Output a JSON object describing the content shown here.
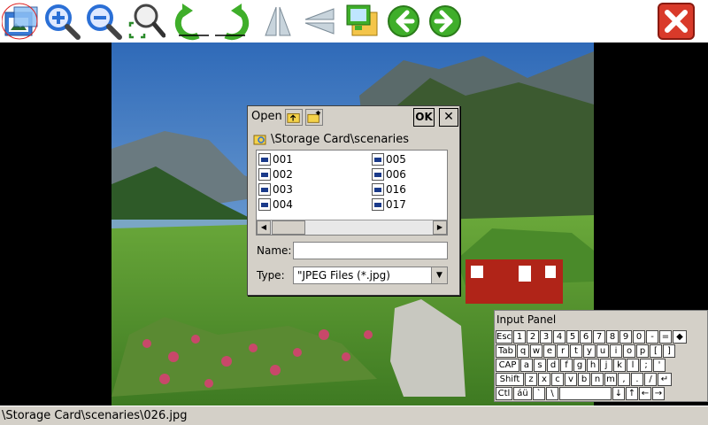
{
  "toolbar": {
    "buttons": [
      {
        "name": "open-image-icon"
      },
      {
        "name": "zoom-in-icon"
      },
      {
        "name": "zoom-out-icon"
      },
      {
        "name": "zoom-fit-icon"
      },
      {
        "name": "rotate-left-icon"
      },
      {
        "name": "rotate-right-icon"
      },
      {
        "name": "flip-horizontal-icon"
      },
      {
        "name": "flip-vertical-icon"
      },
      {
        "name": "slideshow-icon"
      },
      {
        "name": "previous-arrow-icon"
      },
      {
        "name": "next-arrow-icon"
      },
      {
        "name": "close-app-icon"
      }
    ],
    "colors": {
      "accent_green": "#3fae2a",
      "accent_blue": "#2a6fd6",
      "close_red": "#d93a2a"
    }
  },
  "dialog": {
    "title": "Open",
    "ok_label": "OK",
    "close_label": "✕",
    "path": "\\Storage Card\\scenaries",
    "files_col1": [
      "001",
      "002",
      "003",
      "004"
    ],
    "files_col2": [
      "005",
      "006",
      "016",
      "017"
    ],
    "name_label": "Name:",
    "name_value": "",
    "type_label": "Type:",
    "type_value": "\"JPEG Files (*.jpg)"
  },
  "input_panel": {
    "title": "Input Panel",
    "rows": [
      [
        "Esc",
        "1",
        "2",
        "3",
        "4",
        "5",
        "6",
        "7",
        "8",
        "9",
        "0",
        "-",
        "=",
        "◆"
      ],
      [
        "Tab",
        "q",
        "w",
        "e",
        "r",
        "t",
        "y",
        "u",
        "i",
        "o",
        "p",
        "[",
        "]"
      ],
      [
        "CAP",
        "a",
        "s",
        "d",
        "f",
        "g",
        "h",
        "j",
        "k",
        "l",
        ";",
        "'"
      ],
      [
        "Shift",
        "z",
        "x",
        "c",
        "v",
        "b",
        "n",
        "m",
        ",",
        ".",
        "/",
        "↵"
      ],
      [
        "Ctl",
        "áü",
        "`",
        "\\",
        "",
        "↓",
        "↑",
        "←",
        "→"
      ]
    ]
  },
  "status": {
    "path": "\\Storage Card\\scenaries\\026.jpg"
  }
}
